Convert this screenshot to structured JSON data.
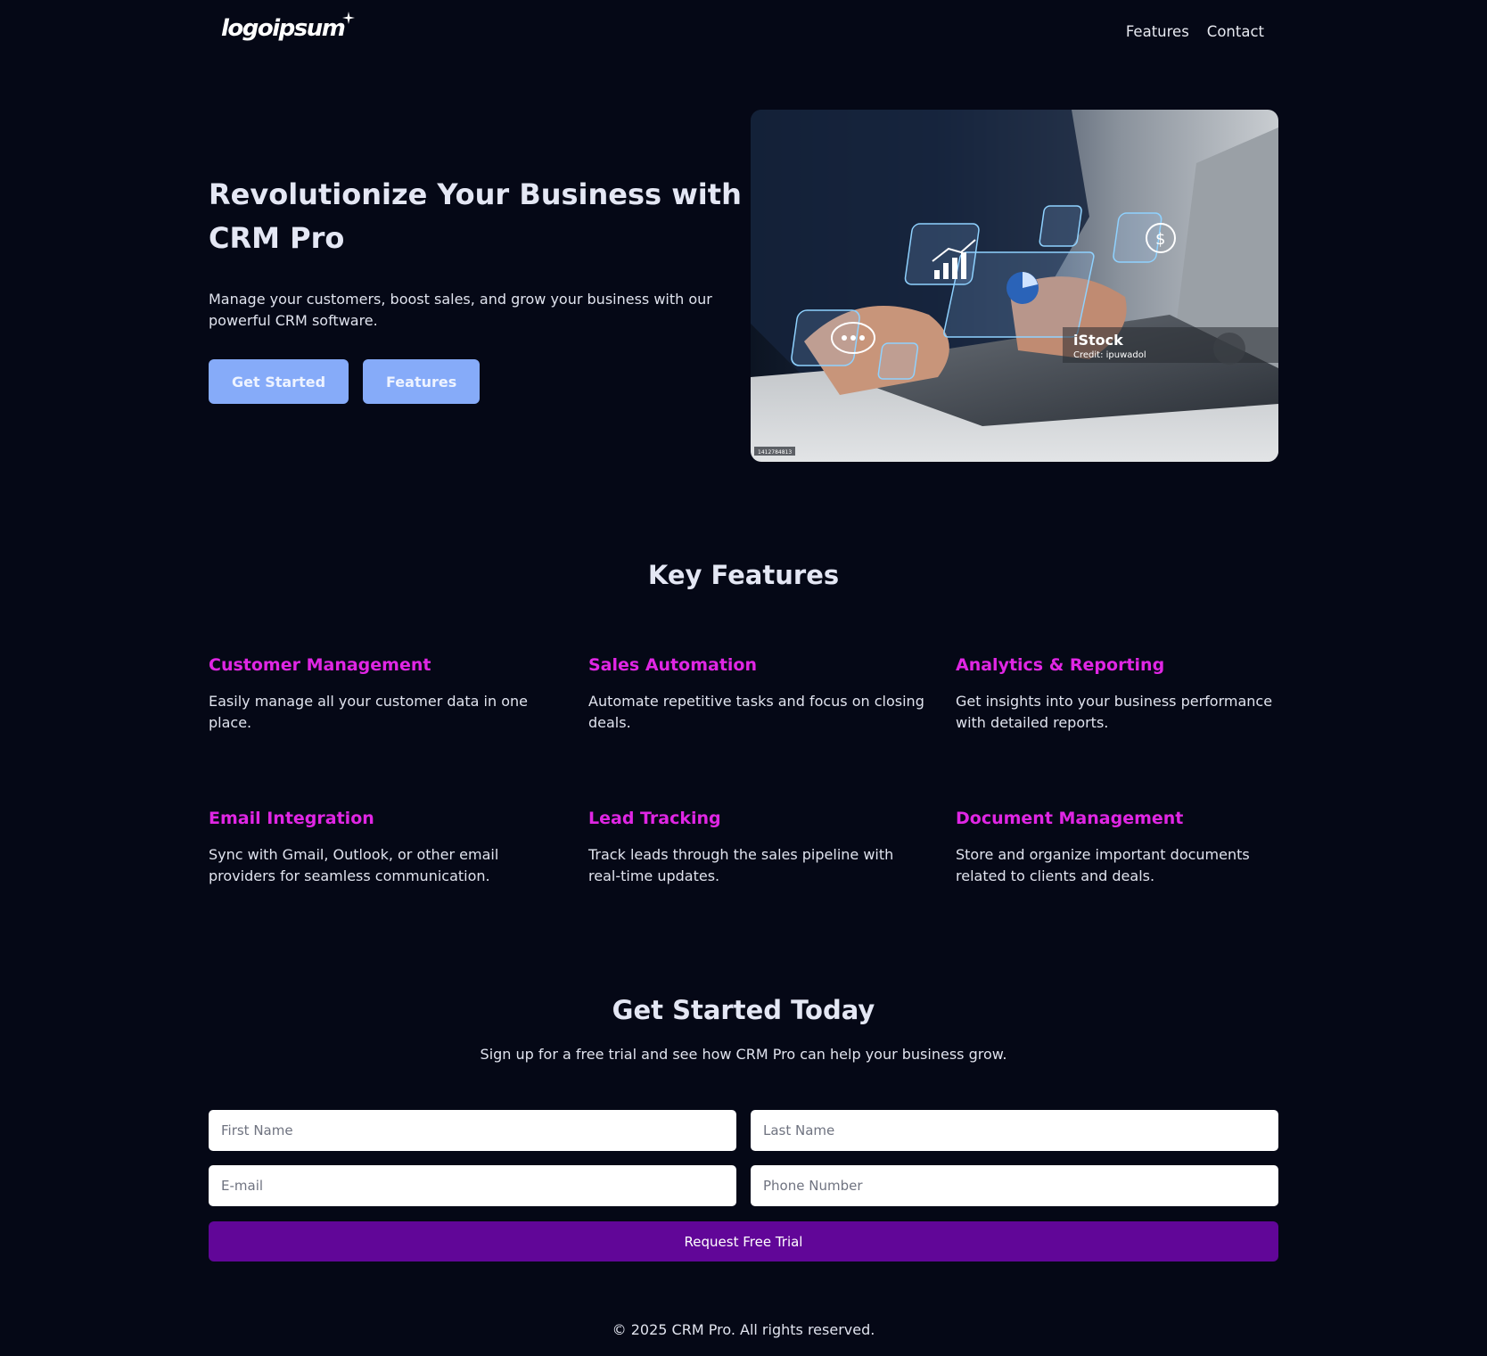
{
  "header": {
    "logo_text": "logoipsum",
    "nav": [
      {
        "label": "Features"
      },
      {
        "label": "Contact"
      }
    ]
  },
  "hero": {
    "title": "Revolutionize Your Business with CRM Pro",
    "subtitle": "Manage your customers, boost sales, and grow your business with our powerful CRM software.",
    "buttons": {
      "primary": "Get Started",
      "secondary": "Features"
    },
    "image": {
      "watermark_brand": "iStock",
      "watermark_credit": "Credit: ipuwadol",
      "stock_id": "1412784813"
    }
  },
  "features": {
    "title": "Key Features",
    "items": [
      {
        "title": "Customer Management",
        "desc": "Easily manage all your customer data in one place."
      },
      {
        "title": "Sales Automation",
        "desc": "Automate repetitive tasks and focus on closing deals."
      },
      {
        "title": "Analytics & Reporting",
        "desc": "Get insights into your business performance with detailed reports."
      },
      {
        "title": "Email Integration",
        "desc": "Sync with Gmail, Outlook, or other email providers for seamless communication."
      },
      {
        "title": "Lead Tracking",
        "desc": "Track leads through the sales pipeline with real-time updates."
      },
      {
        "title": "Document Management",
        "desc": "Store and organize important documents related to clients and deals."
      }
    ]
  },
  "signup": {
    "title": "Get Started Today",
    "subtitle": "Sign up for a free trial and see how CRM Pro can help your business grow.",
    "fields": {
      "first_name": {
        "placeholder": "First Name",
        "value": ""
      },
      "last_name": {
        "placeholder": "Last Name",
        "value": ""
      },
      "email": {
        "placeholder": "E-mail",
        "value": ""
      },
      "phone": {
        "placeholder": "Phone Number",
        "value": ""
      }
    },
    "submit_label": "Request Free Trial"
  },
  "footer": {
    "text": "© 2025 CRM Pro. All rights reserved."
  },
  "colors": {
    "background": "#050816",
    "accent_feature": "#e026e4",
    "button_light": "#86abf9",
    "button_submit": "#610698"
  }
}
